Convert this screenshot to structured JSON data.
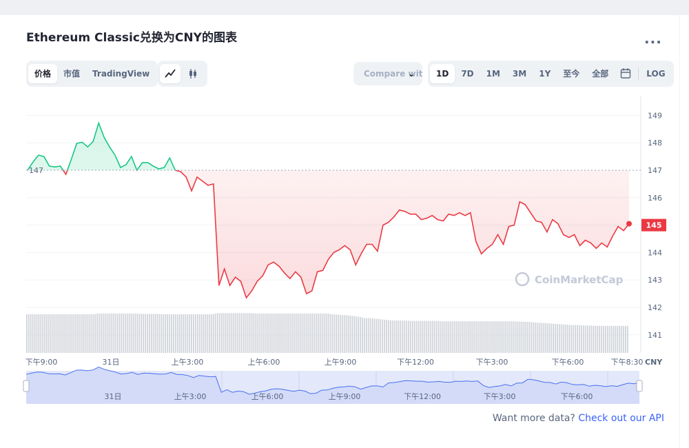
{
  "title": "Ethereum Classic兑换为CNY的图表",
  "more_label": "...",
  "view_tabs": [
    "价格",
    "市值",
    "TradingView"
  ],
  "chart_type_icons": [
    "line-chart-icon",
    "candlestick-icon"
  ],
  "compare_label": "Compare with",
  "range_tabs": [
    "1D",
    "7D",
    "1M",
    "3M",
    "1Y",
    "至今",
    "全部"
  ],
  "calendar_icon": "calendar-icon",
  "log_label": "LOG",
  "currency_label": "CNY",
  "watermark": "CoinMarketCap",
  "footer": {
    "prefix": "Want more data?",
    "link": "Check out our API"
  },
  "colors": {
    "up": "#16c784",
    "down": "#ea3943",
    "volume": "#d0d3d9",
    "navigator_fill": "#e3e8fa",
    "navigator_line": "#4a6ff0",
    "link": "#3861fb"
  },
  "chart_data": {
    "type": "line",
    "ylim": [
      140.5,
      149.5
    ],
    "y_ticks": [
      149,
      148,
      147,
      146,
      145,
      144,
      143,
      142,
      141
    ],
    "reference_value": 147,
    "reference_label": "147",
    "current_value": 145,
    "current_label": "145",
    "x_ticks": [
      "下午9:00",
      "31日",
      "上午3:00",
      "上午6:00",
      "上午9:00",
      "下午12:00",
      "下午3:00",
      "下午6:00",
      "下午8:30"
    ],
    "navigator_ticks": [
      "31日",
      "上午3:00",
      "上午6:00",
      "上午9:00",
      "下午12:00",
      "下午3:00",
      "下午6:00"
    ],
    "price_series": [
      147.0,
      147.3,
      147.55,
      147.5,
      147.15,
      147.12,
      147.15,
      146.85,
      147.4,
      147.98,
      148.02,
      147.85,
      148.05,
      148.72,
      148.2,
      147.85,
      147.55,
      147.1,
      147.2,
      147.5,
      147.0,
      147.28,
      147.28,
      147.15,
      147.05,
      147.1,
      147.45,
      147.0,
      146.95,
      146.75,
      146.25,
      146.75,
      146.6,
      146.45,
      146.5,
      142.8,
      143.4,
      142.8,
      143.1,
      142.95,
      142.35,
      142.6,
      142.95,
      143.15,
      143.55,
      143.65,
      143.5,
      143.25,
      143.05,
      143.3,
      143.1,
      142.5,
      142.6,
      143.3,
      143.35,
      143.75,
      144.0,
      144.1,
      144.25,
      144.1,
      143.55,
      143.95,
      144.3,
      144.3,
      144.05,
      145.0,
      145.1,
      145.3,
      145.55,
      145.5,
      145.4,
      145.4,
      145.2,
      145.25,
      145.35,
      145.2,
      145.15,
      145.4,
      145.35,
      145.45,
      145.35,
      145.45,
      144.4,
      143.95,
      144.15,
      144.3,
      144.65,
      144.3,
      144.95,
      145.0,
      145.85,
      145.75,
      145.45,
      145.15,
      145.1,
      144.75,
      145.2,
      145.05,
      144.65,
      144.55,
      144.65,
      144.25,
      144.45,
      144.35,
      144.15,
      144.35,
      144.2,
      144.6,
      144.95,
      144.8,
      145.05
    ],
    "volume_series": [
      1.0,
      1.0,
      1.0,
      1.0,
      1.0,
      1.0,
      1.0,
      1.0,
      1.0,
      1.0,
      1.0,
      1.0,
      1.0,
      1.02,
      1.02,
      1.02,
      1.02,
      1.02,
      1.02,
      1.02,
      1.02,
      1.01,
      1.01,
      1.01,
      1.01,
      1.0,
      1.0,
      1.0,
      1.0,
      1.0,
      1.0,
      1.0,
      1.0,
      1.0,
      1.0,
      1.03,
      1.03,
      1.03,
      1.03,
      1.03,
      1.03,
      1.03,
      1.02,
      1.02,
      1.02,
      1.02,
      1.02,
      1.02,
      1.02,
      1.02,
      1.02,
      1.02,
      1.02,
      1.02,
      1.02,
      1.02,
      1.0,
      0.99,
      0.98,
      0.97,
      0.95,
      0.93,
      0.9,
      0.9,
      0.88,
      0.87,
      0.85,
      0.84,
      0.84,
      0.84,
      0.83,
      0.83,
      0.83,
      0.83,
      0.83,
      0.83,
      0.82,
      0.82,
      0.82,
      0.82,
      0.82,
      0.82,
      0.82,
      0.82,
      0.82,
      0.82,
      0.82,
      0.82,
      0.82,
      0.82,
      0.81,
      0.81,
      0.8,
      0.79,
      0.78,
      0.77,
      0.76,
      0.75,
      0.74,
      0.73,
      0.72,
      0.72,
      0.71,
      0.71,
      0.7,
      0.7,
      0.7,
      0.7,
      0.7,
      0.7,
      0.7
    ]
  }
}
